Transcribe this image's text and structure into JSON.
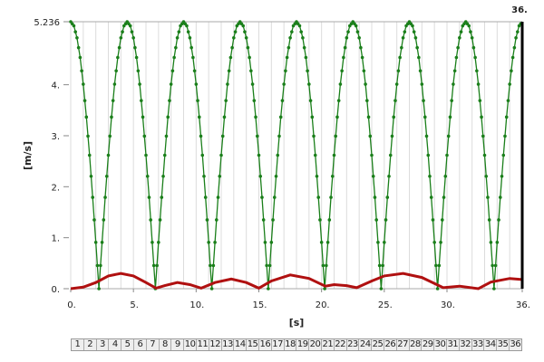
{
  "chart_data": {
    "type": "line",
    "title": "",
    "xlabel": "[s]",
    "ylabel": "[m/s]",
    "xlim": [
      0,
      36
    ],
    "ylim": [
      0,
      5.236
    ],
    "grid": "vertical lines every 1 s",
    "x_ticks": [
      "0.",
      "5.",
      "10.",
      "15.",
      "20.",
      "25.",
      "30.",
      "36."
    ],
    "x_tick_values": [
      0,
      5,
      10,
      15,
      20,
      25,
      30,
      36
    ],
    "y_ticks": [
      "0.",
      "1.",
      "2.",
      "3.",
      "4.",
      "5.236"
    ],
    "y_tick_values": [
      0,
      1,
      2,
      3,
      4,
      5.236
    ],
    "cursor": {
      "label": "36.",
      "value": 36
    },
    "series": [
      {
        "name": "green",
        "color": "#1a7f1a",
        "x_step": 0.25,
        "values": [
          5.236,
          5.156,
          4.92,
          4.535,
          4.011,
          3.366,
          2.618,
          1.791,
          0.909,
          0,
          0.909,
          1.791,
          2.618,
          3.366,
          4.011,
          4.535,
          4.92,
          5.156,
          5.236,
          5.156,
          4.92,
          4.535,
          4.011,
          3.366,
          2.618,
          1.791,
          0.909,
          0,
          0.909,
          1.791,
          2.618,
          3.366,
          4.011,
          4.535,
          4.92,
          5.156,
          5.236,
          5.156,
          4.92,
          4.535,
          4.011,
          3.366,
          2.618,
          1.791,
          0.909,
          0,
          0.909,
          1.791,
          2.618,
          3.366,
          4.011,
          4.535,
          4.92,
          5.156,
          5.236,
          5.156,
          4.92,
          4.535,
          4.011,
          3.366,
          2.618,
          1.791,
          0.909,
          0,
          0.909,
          1.791,
          2.618,
          3.366,
          4.011,
          4.535,
          4.92,
          5.156,
          5.236,
          5.156,
          4.92,
          4.535,
          4.011,
          3.366,
          2.618,
          1.791,
          0.909,
          0,
          0.909,
          1.791,
          2.618,
          3.366,
          4.011,
          4.535,
          4.92,
          5.156,
          5.236,
          5.156,
          4.92,
          4.535,
          4.011,
          3.366,
          2.618,
          1.791,
          0.909,
          0,
          0.909,
          1.791,
          2.618,
          3.366,
          4.011,
          4.535,
          4.92,
          5.156,
          5.236,
          5.156,
          4.92,
          4.535,
          4.011,
          3.366,
          2.618,
          1.791,
          0.909,
          0,
          0.909,
          1.791,
          2.618,
          3.366,
          4.011,
          4.535,
          4.92,
          5.156,
          5.236,
          5.156,
          4.92,
          4.535,
          4.011,
          3.366,
          2.618,
          1.791,
          0.909,
          0,
          0.909,
          1.791,
          2.618,
          3.366,
          4.011,
          4.535,
          4.92,
          5.156,
          5.236
        ]
      },
      {
        "name": "red",
        "color": "#b01010",
        "points": [
          [
            0,
            0
          ],
          [
            1,
            0.03
          ],
          [
            2,
            0.12
          ],
          [
            3,
            0.25
          ],
          [
            4,
            0.3
          ],
          [
            5,
            0.25
          ],
          [
            6,
            0.12
          ],
          [
            6.8,
            0.01
          ],
          [
            7.5,
            0.06
          ],
          [
            8.5,
            0.12
          ],
          [
            9.5,
            0.08
          ],
          [
            10.4,
            0.01
          ],
          [
            11.5,
            0.12
          ],
          [
            12.8,
            0.19
          ],
          [
            14,
            0.12
          ],
          [
            15,
            0.01
          ],
          [
            16,
            0.15
          ],
          [
            17.5,
            0.27
          ],
          [
            19,
            0.2
          ],
          [
            20.3,
            0.05
          ],
          [
            21,
            0.08
          ],
          [
            22,
            0.06
          ],
          [
            22.8,
            0.02
          ],
          [
            24,
            0.15
          ],
          [
            25,
            0.25
          ],
          [
            26.5,
            0.3
          ],
          [
            28,
            0.22
          ],
          [
            29.7,
            0.02
          ],
          [
            31,
            0.05
          ],
          [
            32.5,
            0.0
          ],
          [
            33.5,
            0.13
          ],
          [
            35,
            0.2
          ],
          [
            36,
            0.18
          ]
        ]
      }
    ]
  },
  "index_bar": [
    "1",
    "2",
    "3",
    "4",
    "5",
    "6",
    "7",
    "8",
    "9",
    "10",
    "11",
    "12",
    "13",
    "14",
    "15",
    "16",
    "17",
    "18",
    "19",
    "20",
    "21",
    "22",
    "23",
    "24",
    "25",
    "26",
    "27",
    "28",
    "29",
    "30",
    "31",
    "32",
    "33",
    "34",
    "35",
    "36"
  ]
}
